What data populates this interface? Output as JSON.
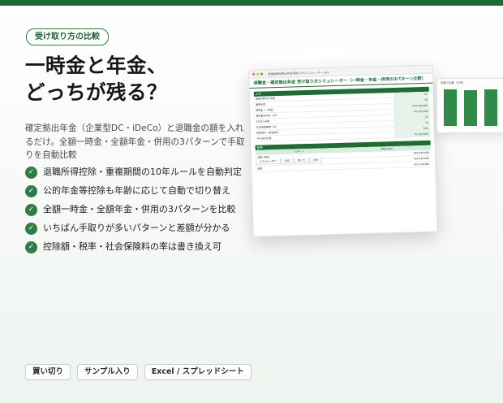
{
  "tag": "受け取り方の比較",
  "headline": {
    "line1": "一時金と年金、",
    "line2": "どっちが残る？"
  },
  "description": "確定拠出年金（企業型DC・iDeCo）と退職金の額を入れるだけ。全額一時金・全額年金・併用の3パターンで手取りを自動比較",
  "check_glyph": "✓",
  "features": [
    "退職所得控除・重複期間の10年ルールを自動判定",
    "公的年金等控除も年齢に応じて自動で切り替え",
    "全額一時金・全額年金・併用の3パターンを比較",
    "いちばん手取りが多いパターンと差額が分かる",
    "控除額・税率・社会保険料の率は書き換え可"
  ],
  "badges": [
    "買い切り",
    "サンプル入り",
    "Excel / スプレッドシート"
  ],
  "preview": {
    "filename": "退職金確定拠出年金受取り方シミュレーター.xlsx",
    "sheet_title": "退職金・確定拠出年金 受け取り方シミュレーター（一時金・年金・併用の3パターン比較）",
    "input_section": "入力",
    "input_rows": [
      {
        "label": "退職日時点の年齢",
        "value": "60"
      },
      {
        "label": "勤続年数",
        "value": "38"
      },
      {
        "label": "退職金（一時金）",
        "value": "¥20,000,000"
      },
      {
        "label": "確定拠出年金（DC）",
        "value": "¥8,000,000"
      },
      {
        "label": "DC加入年数",
        "value": "20"
      },
      {
        "label": "年金受取期間（年）",
        "value": "10"
      },
      {
        "label": "併用時の一時金割合",
        "value": "50%"
      },
      {
        "label": "その他の所得",
        "value": "¥1,800,000"
      }
    ],
    "result_section": "結果",
    "result_head": [
      "パターン",
      "手取り合計"
    ],
    "result_rows": [
      {
        "label": "全額一時金",
        "value": "¥26,950,000"
      },
      {
        "label": "全額年金",
        "value": "¥26,410,000"
      },
      {
        "label": "併用",
        "value": "¥27,120,000"
      }
    ],
    "tabs": [
      "シミュレーター",
      "設定",
      "使い方",
      "比較"
    ],
    "window_dot_colors": [
      "#ff5f57",
      "#febc2e",
      "#28c840"
    ],
    "accent_color": "#1f6b35"
  },
  "chart": {
    "title": "手取り比較（万円）",
    "bar_values": [
      2695,
      2641,
      2712
    ],
    "ylim": [
      0,
      3000
    ],
    "bar_color": "#2e8b48"
  }
}
